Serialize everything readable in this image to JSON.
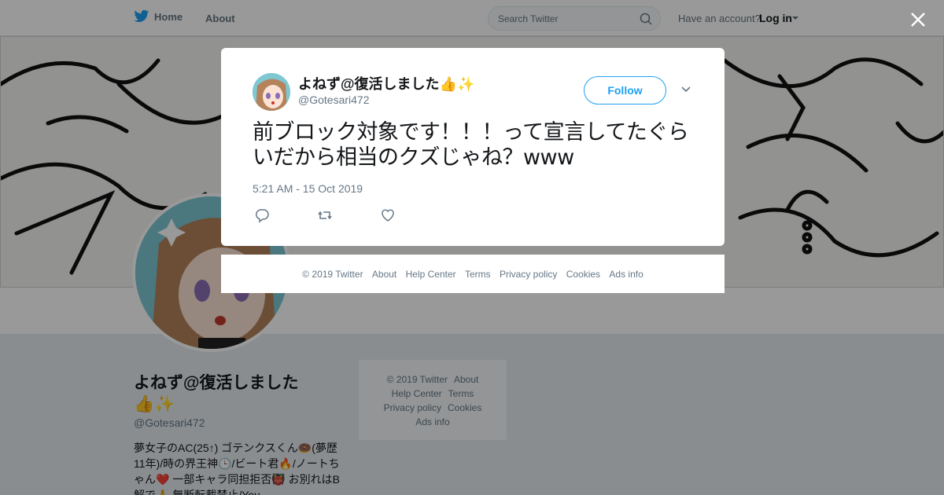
{
  "nav": {
    "home": "Home",
    "about": "About",
    "search_placeholder": "Search Twitter",
    "have_account": "Have an account?",
    "login": "Log in"
  },
  "profile": {
    "name": "よねず@復活しました👍✨",
    "handle": "@Gotesari472",
    "bio": "夢女子のAC(25↑) ゴテンクスくん🍩(夢歴11年)/時の界王神🕒/ビート君🔥/ノートちゃん❤️ 一部キャラ同担拒否👹 お別れはB解で🙏 無断転載禁止/You"
  },
  "side_footer": {
    "copyright": "© 2019 Twitter",
    "about": "About",
    "help": "Help Center",
    "terms": "Terms",
    "privacy": "Privacy policy",
    "cookies": "Cookies",
    "ads": "Ads info"
  },
  "tweet": {
    "name": "よねず@復活しました👍✨",
    "handle": "@Gotesari472",
    "follow": "Follow",
    "text": "前ブロック対象です！！！って宣言してたぐらいだから相当のクズじゃね？www",
    "timestamp": "5:21 AM - 15 Oct 2019"
  },
  "modal_footer": {
    "copyright": "© 2019 Twitter",
    "about": "About",
    "help": "Help Center",
    "terms": "Terms",
    "privacy": "Privacy policy",
    "cookies": "Cookies",
    "ads": "Ads info"
  },
  "colors": {
    "accent": "#1da1f2",
    "muted": "#657786",
    "overlay": "rgba(0,0,0,0.4)"
  }
}
